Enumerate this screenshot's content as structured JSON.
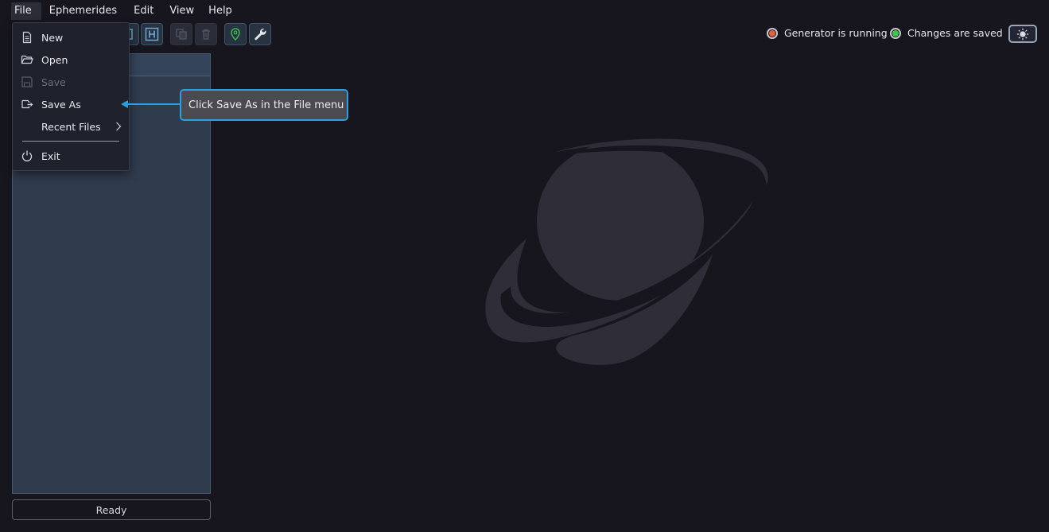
{
  "menubar": {
    "items": [
      {
        "label": "File"
      },
      {
        "label": "Ephemerides"
      },
      {
        "label": "Edit"
      },
      {
        "label": "View"
      },
      {
        "label": "Help"
      }
    ]
  },
  "file_menu": {
    "items": [
      {
        "label": "New",
        "icon": "document-icon"
      },
      {
        "label": "Open",
        "icon": "folder-open-icon"
      },
      {
        "label": "Save",
        "icon": "save-icon",
        "disabled": true
      },
      {
        "label": "Save As",
        "icon": "save-as-icon"
      },
      {
        "label": "Recent Files",
        "icon": "chevron-right-icon"
      },
      {
        "label": "Exit",
        "icon": "power-icon"
      }
    ]
  },
  "tooltip": {
    "text": "Click Save As in the File menu"
  },
  "status": {
    "generator": {
      "label": "Generator is running",
      "color": "#e8613c"
    },
    "saved": {
      "label": "Changes are saved",
      "color": "#3cc84a"
    }
  },
  "left_panel": {
    "status_label": "Ready"
  },
  "colors": {
    "accent": "#2aa0e0",
    "background": "#17161f",
    "panel": "#2f3c4d"
  }
}
